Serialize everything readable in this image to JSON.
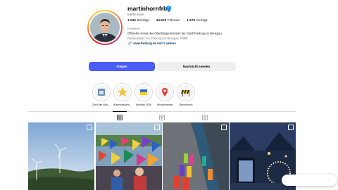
{
  "profile": {
    "username": "martinhornfrbg",
    "full_name": "Martin Horn",
    "stats": {
      "posts_count": "1.542",
      "posts_label": "Beiträge",
      "followers_count": "44.600",
      "followers_label": "Follower",
      "following_count": "1.575",
      "following_label": "Gefolgt"
    },
    "category": "Politiker/in",
    "bio": "Offizieller Kanal des Oberbürgermeisters der Stadt Freiburg im Breisgau",
    "address": "Rathausplatz 2-4, Freiburg im Breisgau 79098",
    "link": "www.freiburg.de und 1 weitere"
  },
  "actions": {
    "follow_label": "Folgen",
    "message_label": "Nachricht senden"
  },
  "highlights": [
    {
      "label": "Zahl der Woc...",
      "icon": "calendar-icon"
    },
    {
      "label": "Adventskalen...",
      "icon": "star-burst-icon"
    },
    {
      "label": "Ukraine 2025",
      "icon": "ukraine-flag-icon"
    },
    {
      "label": "Wochenende",
      "icon": "location-pin-icon"
    },
    {
      "label": "Dienstbach",
      "icon": "construction-barrier-icon"
    }
  ],
  "tabs": [
    {
      "name": "posts",
      "icon": "grid-icon",
      "active": true
    },
    {
      "name": "reels",
      "icon": "reels-icon",
      "active": false
    },
    {
      "name": "tagged",
      "icon": "tagged-icon",
      "active": false
    }
  ],
  "colors": {
    "follow_button": "#4a5df9",
    "message_button": "#efefef",
    "verified": "#0095f6"
  }
}
